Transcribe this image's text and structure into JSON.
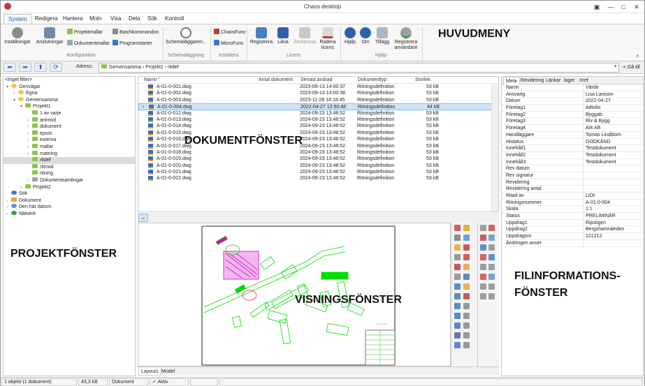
{
  "window": {
    "title": "Chaos desktop",
    "controls": [
      "▣",
      "—",
      "□",
      "✕"
    ]
  },
  "menu_tabs": [
    "System",
    "Redigera",
    "Hantera",
    "Moln",
    "Visa",
    "Dela",
    "Sök",
    "Kontroll"
  ],
  "ribbon": {
    "installningar": "Inställningar",
    "anslutningar": "Anslutningar",
    "projektmallar": "Projektmallar",
    "dokumentmallar": "Dokumentmallar",
    "batchkommandon": "Batchkommandon",
    "programstarter": "Programstarter",
    "konfiguration": "Konfiguration",
    "schemalaggaren": "Schemaläggaren...",
    "schemalaggning": "Schemaläggning",
    "chaosfunc": "ChaosFunc",
    "microfunc": "MicroFunc",
    "installera": "Installera",
    "registrera": "Registrera",
    "lana": "Låna",
    "aterlamna": "Återlämna",
    "radera_licens_1": "Radera",
    "radera_licens_2": "licens",
    "licens": "Licens",
    "hjalp_btn": "Hjälp",
    "om": "Om",
    "tillagg": "Tillägg",
    "registrera_anv_1": "Registrera",
    "registrera_anv_2": "användare",
    "hjalp_group": "Hjälp"
  },
  "address": {
    "label": "Adress:",
    "path": "Gemensamma  ›  Projekt1  ›  ritdef",
    "go": "Gå till"
  },
  "tree": {
    "filter": "<Inget filter>",
    "nodes": [
      {
        "label": "Genvägar",
        "indent": 0,
        "ex": "▾",
        "icon": "star"
      },
      {
        "label": "Egna",
        "indent": 1,
        "ex": "›",
        "icon": "star"
      },
      {
        "label": "Gemensamma",
        "indent": 1,
        "ex": "▾",
        "icon": "star"
      },
      {
        "label": "Projekt1",
        "indent": 2,
        "ex": "▾",
        "icon": "project"
      },
      {
        "label": "1 av varje",
        "indent": 3,
        "ex": "",
        "icon": "folder"
      },
      {
        "label": "anlmod",
        "indent": 3,
        "ex": "›",
        "icon": "folder"
      },
      {
        "label": "dokument",
        "indent": 3,
        "ex": "›",
        "icon": "folder"
      },
      {
        "label": "epost",
        "indent": 3,
        "ex": "›",
        "icon": "folder"
      },
      {
        "label": "externa",
        "indent": 3,
        "ex": "›",
        "icon": "folder"
      },
      {
        "label": "mallar",
        "indent": 3,
        "ex": "›",
        "icon": "folder"
      },
      {
        "label": "matning",
        "indent": 3,
        "ex": "›",
        "icon": "folder"
      },
      {
        "label": "ritdef",
        "indent": 3,
        "ex": "",
        "icon": "folder",
        "selected": true
      },
      {
        "label": "ritmod",
        "indent": 3,
        "ex": "",
        "icon": "folder"
      },
      {
        "label": "ritning",
        "indent": 3,
        "ex": "",
        "icon": "folder"
      },
      {
        "label": "Dokumentsamlingar",
        "indent": 3,
        "ex": "›",
        "icon": "collection"
      },
      {
        "label": "Projekt2",
        "indent": 2,
        "ex": "›",
        "icon": "folder"
      },
      {
        "label": "Sök",
        "indent": 0,
        "ex": "",
        "icon": "search"
      },
      {
        "label": "Dokument",
        "indent": 0,
        "ex": "›",
        "icon": "doc"
      },
      {
        "label": "Den här datorn",
        "indent": 0,
        "ex": "›",
        "icon": "pc"
      },
      {
        "label": "Nätverk",
        "indent": 0,
        "ex": "›",
        "icon": "net"
      }
    ]
  },
  "doclist": {
    "columns": [
      "Namn",
      "Antal dokument",
      "Senast ändrad",
      "Dokumenttyp",
      "Storlek"
    ],
    "rows": [
      [
        "A-01-0-001.dwg",
        "2023-09-13 14:00:37",
        "Ritningsdefinition",
        "53 kB"
      ],
      [
        "A-01-0-002.dwg",
        "2023-09-13 14:00:38",
        "Ritningsdefinition",
        "53 kB"
      ],
      [
        "A-01-0-003.dwg",
        "2023-11-28 14:18:45",
        "Ritningsdefinition",
        "53 kB"
      ],
      [
        "A-01-0-004.dwg",
        "2022-04-27 12:50:48",
        "Ritningsdefinition",
        "44 kB"
      ],
      [
        "A-01-0-012.dwg",
        "2024-09-23 13:48:52",
        "Ritningsdefinition",
        "53 kB"
      ],
      [
        "A-01-0-013.dwg",
        "2024-09-23 13:48:52",
        "Ritningsdefinition",
        "53 kB"
      ],
      [
        "A-01-0-014.dwg",
        "2024-09-23 13:48:52",
        "Ritningsdefinition",
        "53 kB"
      ],
      [
        "A-01-0-015.dwg",
        "2024-09-23 13:48:52",
        "Ritningsdefinition",
        "53 kB"
      ],
      [
        "A-01-0-016.dwg",
        "2024-09-23 13:48:52",
        "Ritningsdefinition",
        "53 kB"
      ],
      [
        "A-01-0-017.dwg",
        "2024-09-23 13:48:52",
        "Ritningsdefinition",
        "53 kB"
      ],
      [
        "A-01-0-018.dwg",
        "2024-09-23 13:48:52",
        "Ritningsdefinition",
        "53 kB"
      ],
      [
        "A-01-0-019.dwg",
        "2024-09-23 13:48:52",
        "Ritningsdefinition",
        "53 kB"
      ],
      [
        "A-01-0-020.dwg",
        "2024-09-23 13:48:52",
        "Ritningsdefinition",
        "53 kB"
      ],
      [
        "A-01-0-021.dwg",
        "2024-09-23 13:48:52",
        "Ritningsdefinition",
        "53 kB"
      ],
      [
        "A-01-0-022.dwg",
        "2024-09-23 13:48:52",
        "Ritningsdefinition",
        "53 kB"
      ]
    ],
    "selected_row": 3
  },
  "viewer_tabs": [
    "Layout1",
    "Model"
  ],
  "meta": {
    "tabs": [
      "Meta",
      "Revidering",
      "Länkar",
      "lager",
      "Xref"
    ],
    "header_name": "Namn",
    "header_value": "Värde",
    "rows": [
      [
        "Ansvarig",
        "Lisa Larsson"
      ],
      [
        "Datum",
        "2022-04-27"
      ],
      [
        "Företag1",
        "Adtollo"
      ],
      [
        "Företag2",
        "Byggab"
      ],
      [
        "Företag3",
        "Riv & Bygg"
      ],
      [
        "Företag4",
        "Ark AB"
      ],
      [
        "Handläggare",
        "Tomas Lindblom"
      ],
      [
        "Histatus",
        "GODKÄND"
      ],
      [
        "Innehåll1",
        "Testdokument"
      ],
      [
        "Innehåll2",
        "Testdokument"
      ],
      [
        "Innehåll3",
        "Testdokument"
      ],
      [
        "Rev datum",
        ""
      ],
      [
        "Rev signatur",
        ""
      ],
      [
        "Revidering",
        ""
      ],
      [
        "Revidering antal",
        ""
      ],
      [
        "Ritad av",
        "LIOI"
      ],
      [
        "Ritningsnummer",
        "A-01-0-004"
      ],
      [
        "Skala",
        "1:1"
      ],
      [
        "Status",
        "PRELIMINÄR"
      ],
      [
        "Uppdrag1",
        "Ripstigen"
      ],
      [
        "Uppdrag2",
        "Bergshamraleden"
      ],
      [
        "Uppdragsnr",
        "121212"
      ],
      [
        "Ändringen avser",
        ""
      ]
    ]
  },
  "status": {
    "selection": "1 objekt (1 dokument)",
    "size": "43,3 kB",
    "type": "Dokument",
    "state": "Aktiv"
  },
  "overlay_labels": {
    "huvudmeny": "HUVUDMENY",
    "dokumentfonster": "DOKUMENTFÖNSTER",
    "projektfonster": "PROJEKTFÖNSTER",
    "visningsfonster": "VISNINGSFÖNSTER",
    "filinfo_1": "FILINFORMATIONS-",
    "filinfo_2": "FÖNSTER"
  },
  "colors": {
    "accent": "#1a5fa8",
    "selection": "#cce4f7",
    "green": "#00dd00",
    "magenta": "#e000d0"
  }
}
